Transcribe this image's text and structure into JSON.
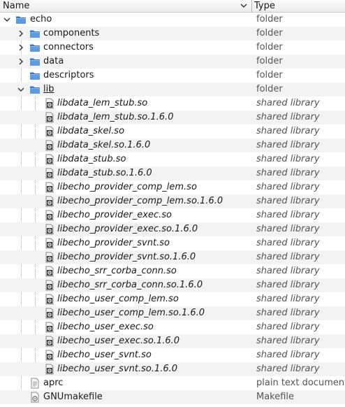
{
  "columns": {
    "name": "Name",
    "type": "Type"
  },
  "colors": {
    "folder": "#4a8bd4",
    "stripe": "#f3f3f3",
    "type_text": "#555555"
  },
  "rows": [
    {
      "name": "echo",
      "type": "folder",
      "depth": 0,
      "icon": "folder-icon",
      "expander": "expanded",
      "italic": false
    },
    {
      "name": "components",
      "type": "folder",
      "depth": 1,
      "icon": "folder-icon",
      "expander": "collapsed",
      "italic": false
    },
    {
      "name": "connectors",
      "type": "folder",
      "depth": 1,
      "icon": "folder-icon",
      "expander": "collapsed",
      "italic": false
    },
    {
      "name": "data",
      "type": "folder",
      "depth": 1,
      "icon": "folder-icon",
      "expander": "collapsed",
      "italic": false
    },
    {
      "name": "descriptors",
      "type": "folder",
      "depth": 1,
      "icon": "folder-icon",
      "expander": "none",
      "italic": false
    },
    {
      "name": "lib",
      "type": "folder",
      "depth": 1,
      "icon": "folder-icon",
      "expander": "expanded",
      "italic": false,
      "underline": true
    },
    {
      "name": "libdata_lem_stub.so",
      "type": "shared library",
      "depth": 2,
      "icon": "shared-library-icon",
      "expander": "none",
      "italic": true
    },
    {
      "name": "libdata_lem_stub.so.1.6.0",
      "type": "shared library",
      "depth": 2,
      "icon": "shared-library-icon",
      "expander": "none",
      "italic": true
    },
    {
      "name": "libdata_skel.so",
      "type": "shared library",
      "depth": 2,
      "icon": "shared-library-icon",
      "expander": "none",
      "italic": true
    },
    {
      "name": "libdata_skel.so.1.6.0",
      "type": "shared library",
      "depth": 2,
      "icon": "shared-library-icon",
      "expander": "none",
      "italic": true
    },
    {
      "name": "libdata_stub.so",
      "type": "shared library",
      "depth": 2,
      "icon": "shared-library-icon",
      "expander": "none",
      "italic": true
    },
    {
      "name": "libdata_stub.so.1.6.0",
      "type": "shared library",
      "depth": 2,
      "icon": "shared-library-icon",
      "expander": "none",
      "italic": true
    },
    {
      "name": "libecho_provider_comp_lem.so",
      "type": "shared library",
      "depth": 2,
      "icon": "shared-library-icon",
      "expander": "none",
      "italic": true
    },
    {
      "name": "libecho_provider_comp_lem.so.1.6.0",
      "type": "shared library",
      "depth": 2,
      "icon": "shared-library-icon",
      "expander": "none",
      "italic": true
    },
    {
      "name": "libecho_provider_exec.so",
      "type": "shared library",
      "depth": 2,
      "icon": "shared-library-icon",
      "expander": "none",
      "italic": true
    },
    {
      "name": "libecho_provider_exec.so.1.6.0",
      "type": "shared library",
      "depth": 2,
      "icon": "shared-library-icon",
      "expander": "none",
      "italic": true
    },
    {
      "name": "libecho_provider_svnt.so",
      "type": "shared library",
      "depth": 2,
      "icon": "shared-library-icon",
      "expander": "none",
      "italic": true
    },
    {
      "name": "libecho_provider_svnt.so.1.6.0",
      "type": "shared library",
      "depth": 2,
      "icon": "shared-library-icon",
      "expander": "none",
      "italic": true
    },
    {
      "name": "libecho_srr_corba_conn.so",
      "type": "shared library",
      "depth": 2,
      "icon": "shared-library-icon",
      "expander": "none",
      "italic": true
    },
    {
      "name": "libecho_srr_corba_conn.so.1.6.0",
      "type": "shared library",
      "depth": 2,
      "icon": "shared-library-icon",
      "expander": "none",
      "italic": true
    },
    {
      "name": "libecho_user_comp_lem.so",
      "type": "shared library",
      "depth": 2,
      "icon": "shared-library-icon",
      "expander": "none",
      "italic": true
    },
    {
      "name": "libecho_user_comp_lem.so.1.6.0",
      "type": "shared library",
      "depth": 2,
      "icon": "shared-library-icon",
      "expander": "none",
      "italic": true
    },
    {
      "name": "libecho_user_exec.so",
      "type": "shared library",
      "depth": 2,
      "icon": "shared-library-icon",
      "expander": "none",
      "italic": true
    },
    {
      "name": "libecho_user_exec.so.1.6.0",
      "type": "shared library",
      "depth": 2,
      "icon": "shared-library-icon",
      "expander": "none",
      "italic": true
    },
    {
      "name": "libecho_user_svnt.so",
      "type": "shared library",
      "depth": 2,
      "icon": "shared-library-icon",
      "expander": "none",
      "italic": true
    },
    {
      "name": "libecho_user_svnt.so.1.6.0",
      "type": "shared library",
      "depth": 2,
      "icon": "shared-library-icon",
      "expander": "none",
      "italic": true
    },
    {
      "name": "aprc",
      "type": "plain text document",
      "depth": 1,
      "icon": "text-file-icon",
      "expander": "none",
      "italic": false
    },
    {
      "name": "GNUmakefile",
      "type": "Makefile",
      "depth": 1,
      "icon": "makefile-icon",
      "expander": "none",
      "italic": false
    }
  ]
}
